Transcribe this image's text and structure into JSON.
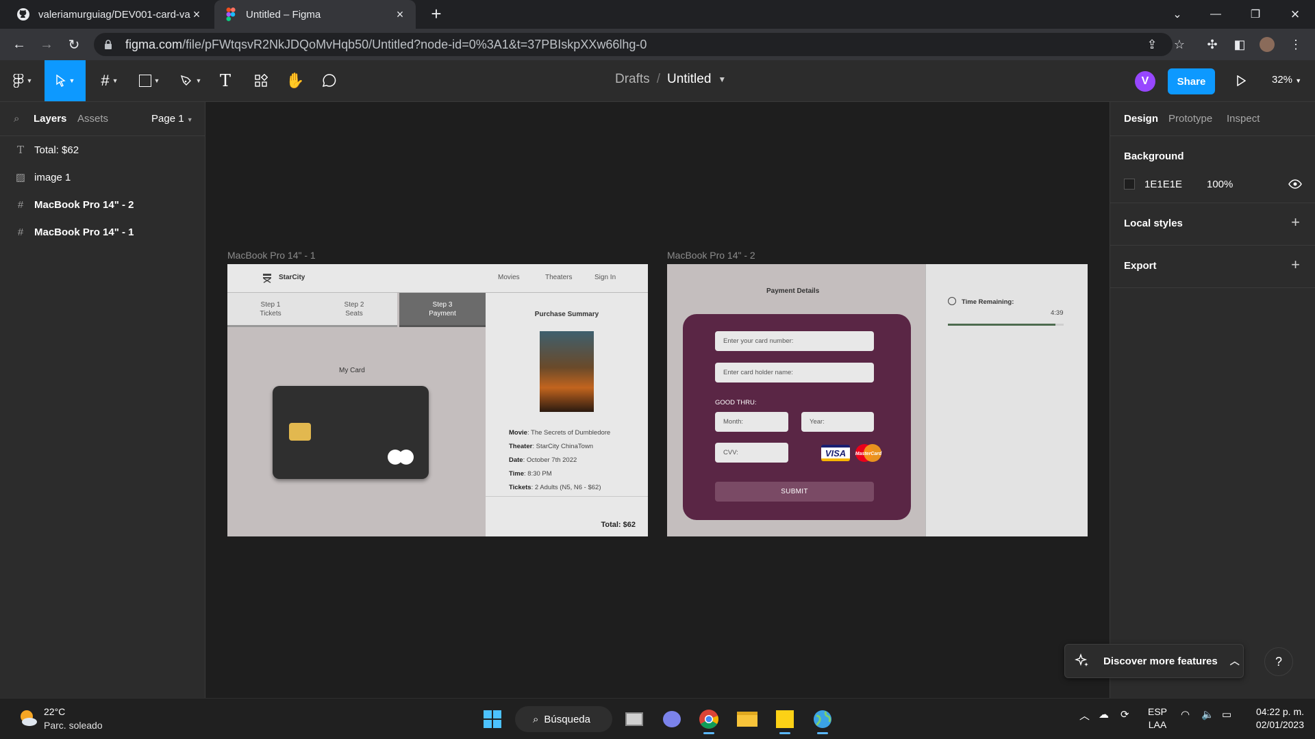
{
  "browser": {
    "tabs": [
      {
        "title": "valeriamurguiag/DEV001-card-va",
        "icon": "github-icon"
      },
      {
        "title": "Untitled – Figma",
        "icon": "figma-icon"
      }
    ],
    "url_host": "figma.com",
    "url_path": "/file/pFWtqsvR2NkJDQoMvHqb50/Untitled?node-id=0%3A1&t=37PBIskpXXw66lhg-0"
  },
  "figma": {
    "breadcrumb_root": "Drafts",
    "breadcrumb_sep": "/",
    "file_name": "Untitled",
    "avatar_initial": "V",
    "share_label": "Share",
    "zoom": "32%"
  },
  "left_panel": {
    "tab_layers": "Layers",
    "tab_assets": "Assets",
    "page": "Page 1",
    "layers": [
      {
        "name": "Total: $62",
        "type": "text"
      },
      {
        "name": "image 1",
        "type": "image"
      },
      {
        "name": "MacBook Pro 14\" - 2",
        "type": "frame"
      },
      {
        "name": "MacBook Pro 14\" - 1",
        "type": "frame"
      }
    ]
  },
  "frame1": {
    "label": "MacBook Pro 14\" - 1",
    "brand": "StarCity",
    "nav": [
      "Movies",
      "Theaters",
      "Sign In"
    ],
    "steps": [
      {
        "line1": "Step 1",
        "line2": "Tickets"
      },
      {
        "line1": "Step 2",
        "line2": "Seats"
      },
      {
        "line1": "Step 3",
        "line2": "Payment"
      }
    ],
    "my_card": "My Card",
    "summary_title": "Purchase Summary",
    "details": [
      {
        "k": "Movie",
        "v": ": The Secrets of Dumbledore"
      },
      {
        "k": "Theater",
        "v": ": StarCity ChinaTown"
      },
      {
        "k": "Date",
        "v": ": October 7th 2022"
      },
      {
        "k": "Time",
        "v": ": 8:30 PM"
      },
      {
        "k": "Tickets",
        "v": ": 2 Adults (N5, N6 - $62)"
      }
    ],
    "total": "Total: $62"
  },
  "frame2": {
    "label": "MacBook Pro 14\" - 2",
    "title": "Payment Details",
    "card_number_placeholder": "Enter your card number:",
    "holder_placeholder": "Enter card holder name:",
    "good_thru": "GOOD THRU:",
    "month_placeholder": "Month:",
    "year_placeholder": "Year:",
    "cvv_placeholder": "CVV:",
    "visa": "VISA",
    "mastercard": "MasterCard",
    "submit": "SUBMIT",
    "time_label": "Time Remaining:",
    "time_value": "4:39",
    "time_progress": 0.93
  },
  "right_panel": {
    "tabs": [
      "Design",
      "Prototype",
      "Inspect"
    ],
    "background_title": "Background",
    "bg_hex": "1E1E1E",
    "bg_opacity": "100%",
    "local_styles": "Local styles",
    "export": "Export",
    "discover": "Discover more features",
    "help": "?"
  },
  "taskbar": {
    "temp": "22°C",
    "weather": "Parc. soleado",
    "search": "Búsqueda",
    "lang_line1": "ESP",
    "lang_line2": "LAA",
    "time": "04:22 p. m.",
    "date": "02/01/2023"
  },
  "colors": {
    "accent": "#0d99ff",
    "form_bg": "#5a2645",
    "canvas": "#1e1e1e"
  }
}
